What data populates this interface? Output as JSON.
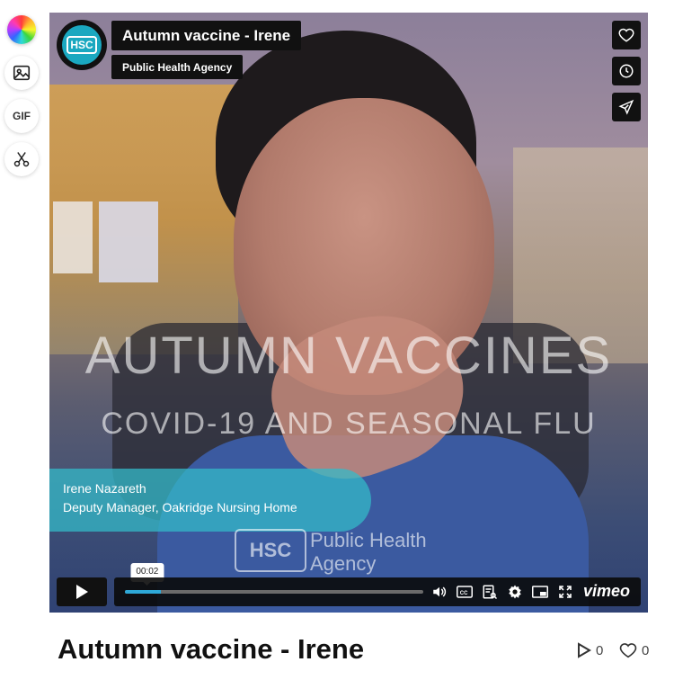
{
  "rail": {
    "gif_label": "GIF"
  },
  "player": {
    "title": "Autumn vaccine - Irene",
    "owner": "Public Health Agency",
    "channel_logo_text": "HSC",
    "overlay": {
      "line1": "AUTUMN VACCINES",
      "line2": "COVID-19 AND SEASONAL FLU"
    },
    "lower_third": {
      "name": "Irene Nazareth",
      "role": "Deputy Manager, Oakridge Nursing Home"
    },
    "watermark": {
      "logo_text": "HSC",
      "line1": "Public Health",
      "line2": "Agency"
    },
    "controls": {
      "current_time": "00:02",
      "progress_fraction": 0.12,
      "brand": "vimeo"
    },
    "colors": {
      "progress": "#2ea8d8",
      "lower_third": "#34bac8"
    }
  },
  "below": {
    "title": "Autumn vaccine - Irene",
    "plays": "0",
    "likes": "0"
  }
}
